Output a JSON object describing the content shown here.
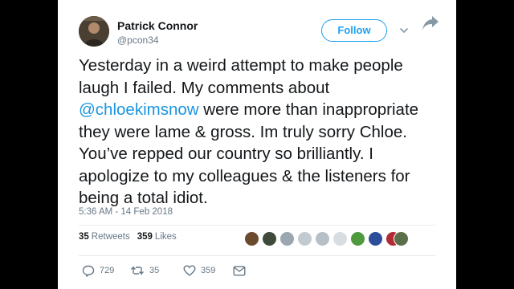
{
  "user": {
    "display_name": "Patrick Connor",
    "handle": "@pcon34"
  },
  "follow_label": "Follow",
  "tweet": {
    "text_before": "Yesterday in a weird attempt to make people laugh I failed. My comments about ",
    "mention": "@chloekimsnow",
    "text_after": " were more than inappropriate they were lame & gross. Im truly sorry Chloe. You’ve repped our country so brilliantly. I apologize to my colleagues & the listeners for being a total idiot.",
    "timestamp": "5:36 AM - 14 Feb 2018"
  },
  "stats": {
    "retweets_count": "35",
    "retweets_label": "Retweets",
    "likes_count": "359",
    "likes_label": "Likes"
  },
  "actions": {
    "reply_count": "729",
    "retweet_count": "35",
    "like_count": "359"
  },
  "colors": {
    "accent": "#1da1f2",
    "mention": "#1b95e0",
    "text": "#14171a",
    "secondary": "#657786"
  },
  "icons": [
    "caret-down-icon",
    "share-icon",
    "reply-icon",
    "retweet-icon",
    "heart-icon",
    "mail-icon"
  ]
}
